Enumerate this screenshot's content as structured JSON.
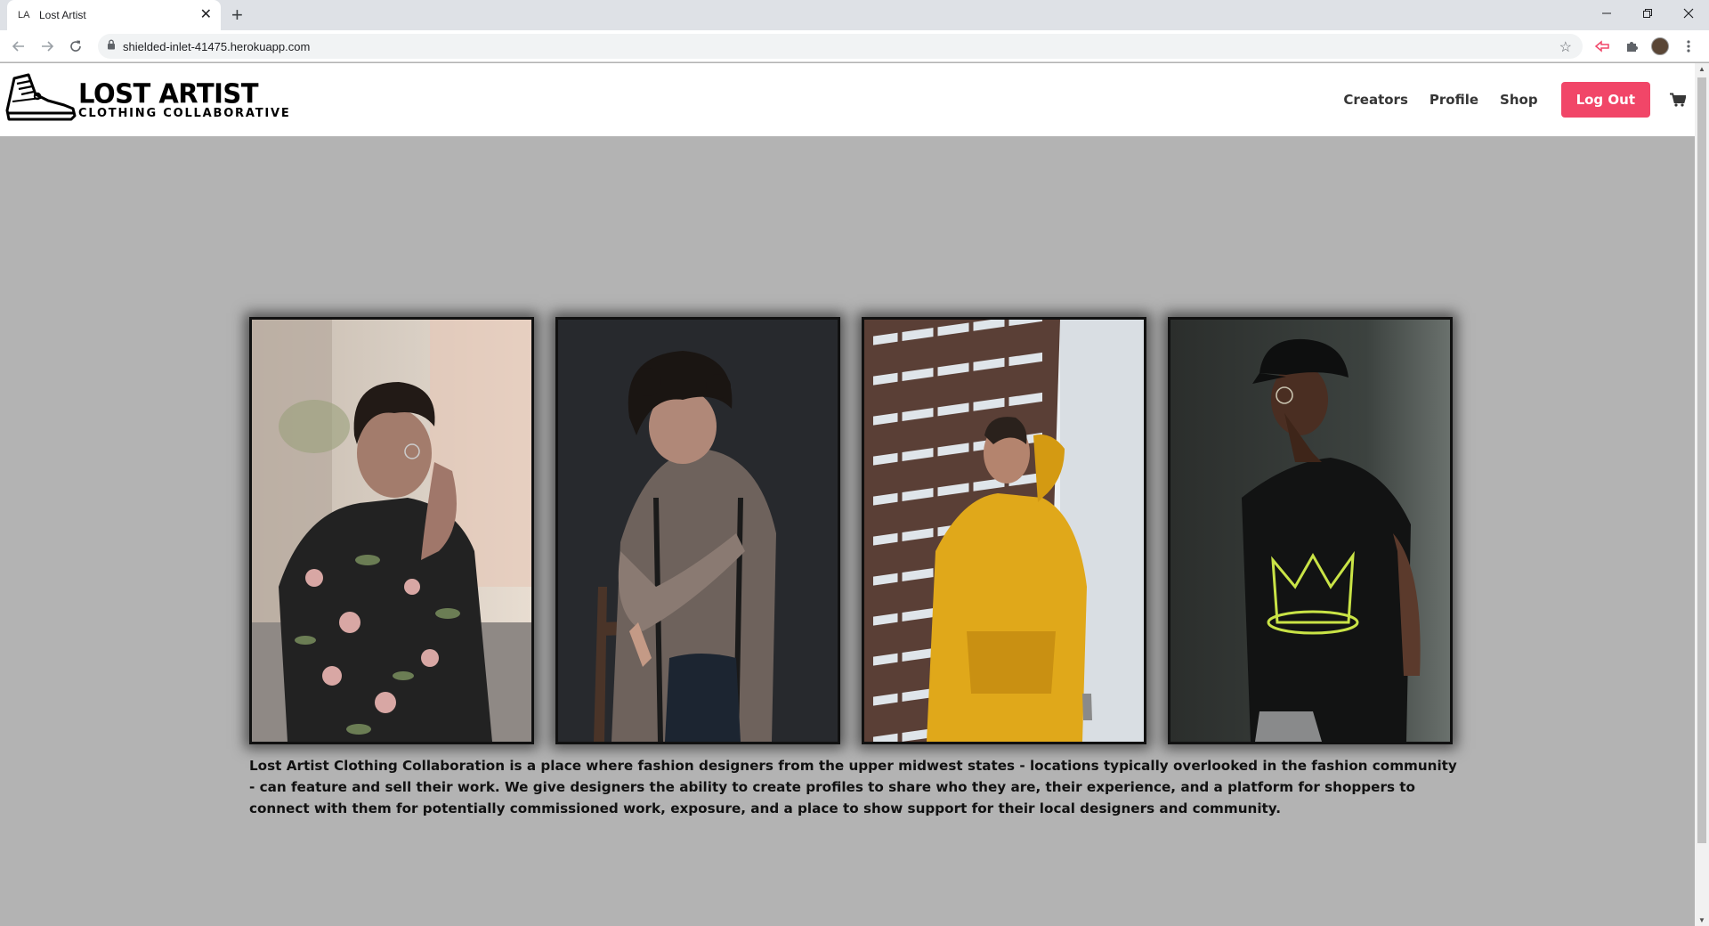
{
  "browser": {
    "tab_favicon": "LA",
    "tab_title": "Lost Artist",
    "url": "shielded-inlet-41475.herokuapp.com",
    "icons": [
      "back-icon",
      "forward-icon",
      "reload-icon",
      "lock-icon",
      "star-icon",
      "extension-icon",
      "puzzle-icon",
      "profile-avatar",
      "menu-icon"
    ]
  },
  "header": {
    "logo_title": "LOST ARTIST",
    "logo_subtitle": "CLOTHING COLLABORATIVE",
    "nav": [
      "Creators",
      "Profile",
      "Shop"
    ],
    "logout_label": "Log Out",
    "logout_color": "#f14668"
  },
  "gallery": {
    "photos": [
      {
        "subject": "man in floral shirt",
        "icon": "photo"
      },
      {
        "subject": "man with curly hair on chair",
        "icon": "photo"
      },
      {
        "subject": "man in yellow hoodie",
        "icon": "photo"
      },
      {
        "subject": "man in black cap and crown t-shirt",
        "icon": "photo"
      }
    ]
  },
  "about": {
    "text": "Lost Artist Clothing Collaboration is a place where fashion designers from the upper midwest states - locations typically overlooked in the fashion community - can feature and sell their work. We give designers the ability to create profiles to share who they are, their experience, and a platform for shoppers to connect with them for potentially commissioned work, exposure, and a place to show support for their local designers and community."
  },
  "colors": {
    "page_background": "#b3b3b3",
    "header_background": "#ffffff",
    "nav_text": "#363636"
  }
}
